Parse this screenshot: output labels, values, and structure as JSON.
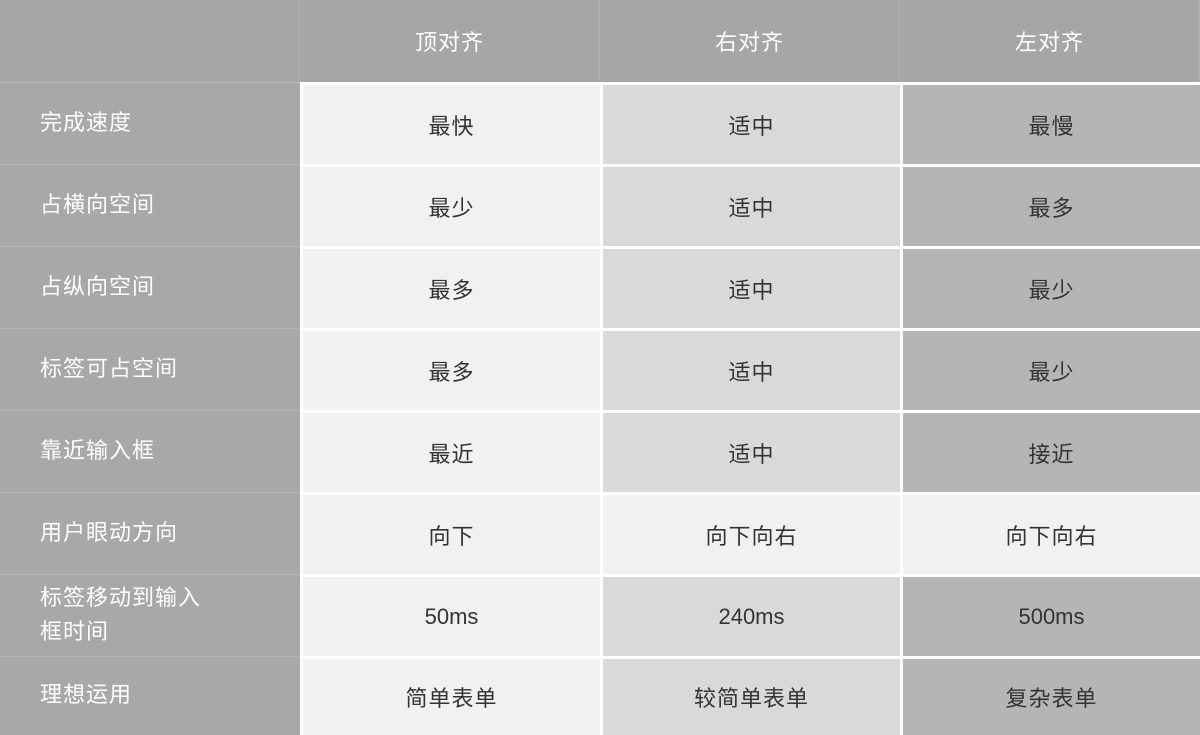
{
  "headers": [
    "",
    "顶对齐",
    "右对齐",
    "左对齐"
  ],
  "rows": [
    {
      "label": "完成速度",
      "values": [
        "最快",
        "适中",
        "最慢"
      ]
    },
    {
      "label": "占横向空间",
      "values": [
        "最少",
        "适中",
        "最多"
      ]
    },
    {
      "label": "占纵向空间",
      "values": [
        "最多",
        "适中",
        "最少"
      ]
    },
    {
      "label": "标签可占空间",
      "values": [
        "最多",
        "适中",
        "最少"
      ]
    },
    {
      "label": "靠近输入框",
      "values": [
        "最近",
        "适中",
        "接近"
      ]
    },
    {
      "label": "用户眼动方向",
      "values": [
        "向下",
        "向下向右",
        "向下向右"
      ]
    },
    {
      "label": "标签移动到输入框时间",
      "values": [
        "50ms",
        "240ms",
        "500ms"
      ]
    },
    {
      "label": "理想运用",
      "values": [
        "简单表单",
        "较简单表单",
        "复杂表单"
      ]
    }
  ],
  "colors": {
    "header_bg": "#a6a6a6",
    "label_bg": "#a8a8a8",
    "col1_bg": "#f1f1f1",
    "col2_bg": "#d9d9d9",
    "col3_bg": "#b5b5b5",
    "text": "#333333"
  }
}
